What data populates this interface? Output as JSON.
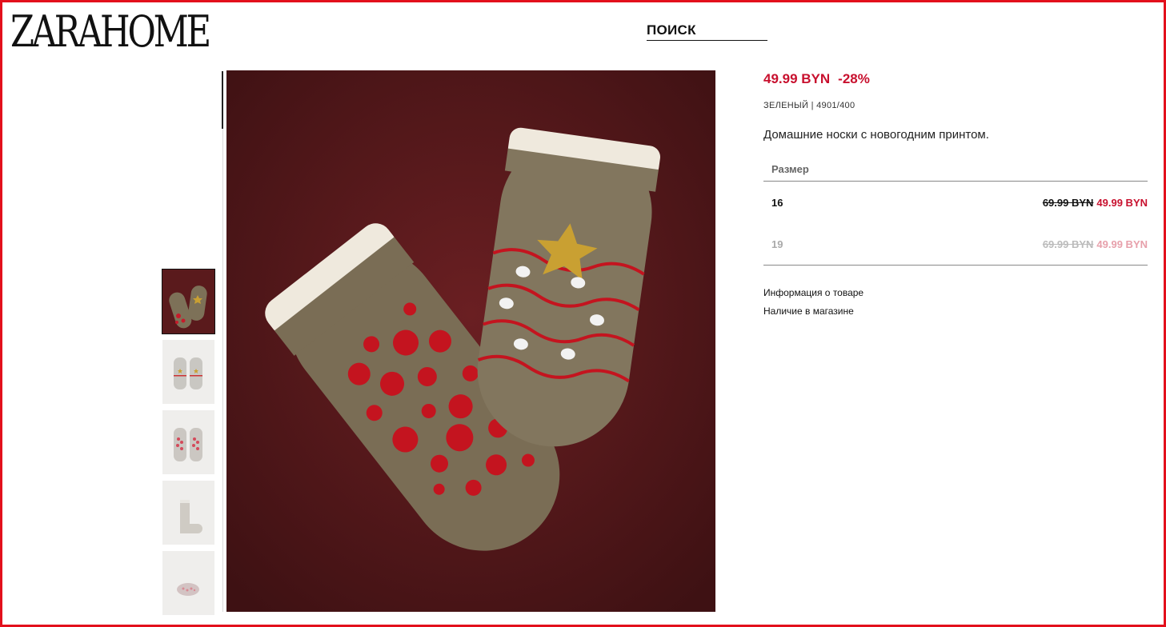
{
  "brand": {
    "logo_text": "ZARAHOME"
  },
  "search": {
    "label": "ПОИСК"
  },
  "gallery": {
    "thumbnails": [
      {
        "alt": "thumb-1",
        "active": true
      },
      {
        "alt": "thumb-2",
        "active": false
      },
      {
        "alt": "thumb-3",
        "active": false
      },
      {
        "alt": "thumb-4",
        "active": false
      },
      {
        "alt": "thumb-5",
        "active": false
      }
    ]
  },
  "product": {
    "price": "49.99 BYN",
    "discount": "-28%",
    "color": "ЗЕЛЕНЫЙ",
    "separator": " | ",
    "reference": "4901/400",
    "description": "Домашние носки с новогодним принтом.",
    "size_header": "Размер",
    "sizes": [
      {
        "size": "16",
        "old_price": "69.99 BYN",
        "new_price": "49.99 BYN",
        "available": true
      },
      {
        "size": "19",
        "old_price": "69.99 BYN",
        "new_price": "49.99 BYN",
        "available": false
      }
    ],
    "links": {
      "product_info": "Информация о товаре",
      "store_availability": "Наличие в магазине"
    }
  },
  "colors": {
    "accent": "#c8102e",
    "frame": "#e3101c",
    "background_img": "#5e1a1c"
  }
}
